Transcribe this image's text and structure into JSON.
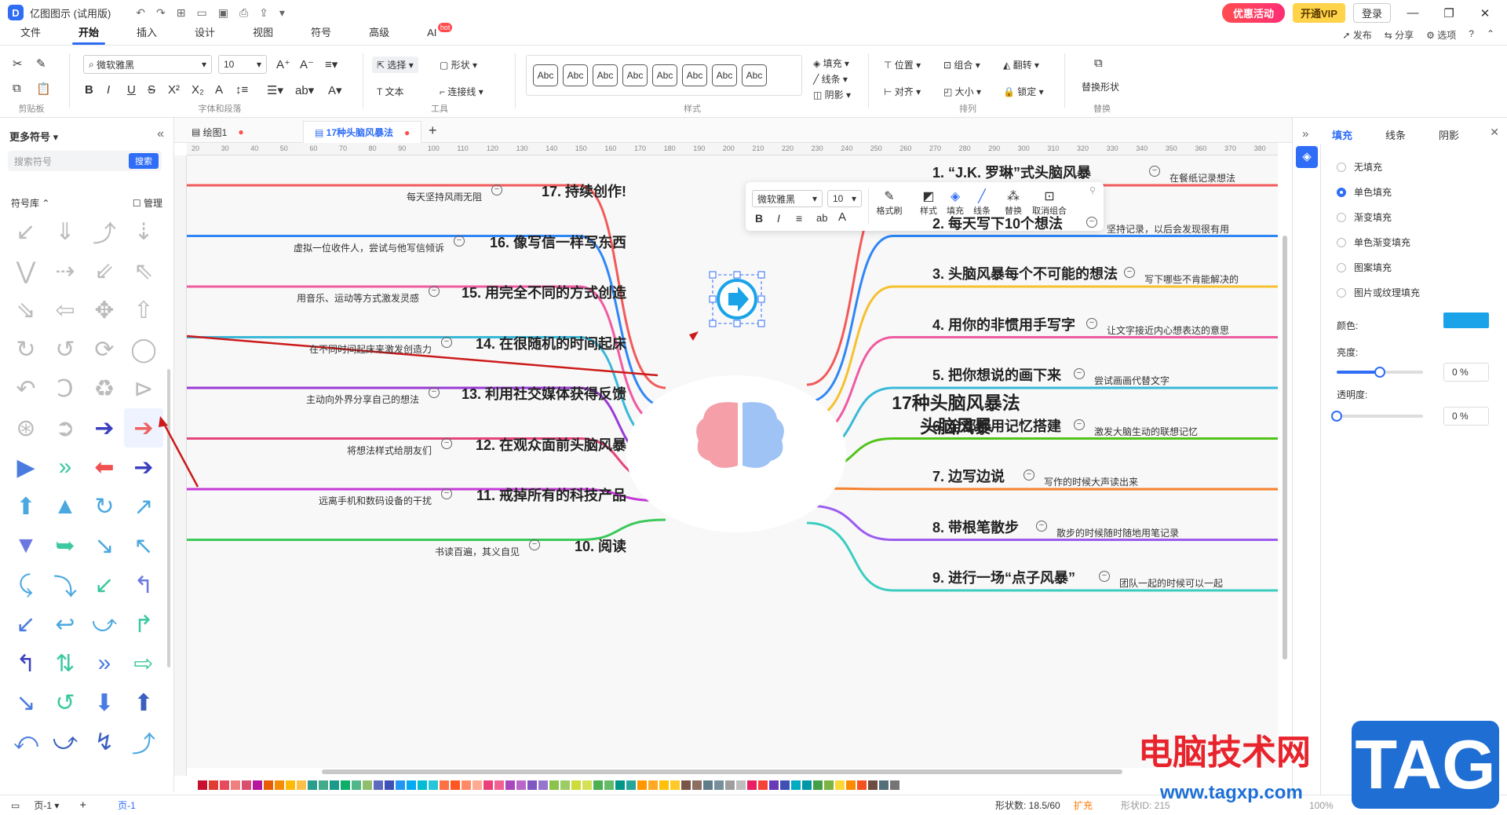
{
  "app": {
    "title": "亿图图示 (试用版)",
    "promo": "优惠活动",
    "vip": "开通VIP",
    "login": "登录"
  },
  "menu": [
    {
      "label": "文件"
    },
    {
      "label": "开始"
    },
    {
      "label": "插入"
    },
    {
      "label": "设计"
    },
    {
      "label": "视图"
    },
    {
      "label": "符号"
    },
    {
      "label": "高级"
    },
    {
      "label": "AI"
    }
  ],
  "menu_hot": "hot",
  "menu_right": {
    "publish": "发布",
    "share": "分享",
    "options": "选项"
  },
  "ribbon": {
    "clipboard_label": "剪贴板",
    "font_name": "微软雅黑",
    "font_size": "10",
    "font_label": "字体和段落",
    "select": "选择",
    "shape": "形状",
    "text": "文本",
    "connector": "连接线",
    "tools_label": "工具",
    "style_label": "样式",
    "fill": "填充",
    "line": "线条",
    "shadow": "阴影",
    "position": "位置",
    "group": "组合",
    "flip": "翻转",
    "align": "对齐",
    "size": "大小",
    "lock": "锁定",
    "arrange_label": "排列",
    "replace_shape": "替换形状",
    "replace_label": "替换",
    "abc": "Abc"
  },
  "left_panel": {
    "title": "更多符号",
    "search_placeholder": "搜索符号",
    "search_btn": "搜索",
    "library": "符号库",
    "manage": "管理"
  },
  "tabs": [
    {
      "label": "绘图1"
    },
    {
      "label": "17种头脑风暴法"
    }
  ],
  "ruler_ticks": [
    "20",
    "30",
    "40",
    "50",
    "60",
    "70",
    "80",
    "90",
    "100",
    "110",
    "120",
    "130",
    "140",
    "150",
    "160",
    "170",
    "180",
    "190",
    "200",
    "210",
    "220",
    "230",
    "240",
    "250",
    "260",
    "270",
    "280",
    "290",
    "300",
    "310",
    "320",
    "330",
    "340",
    "350",
    "360",
    "370",
    "380"
  ],
  "floating_toolbar": {
    "font": "微软雅黑",
    "size": "10",
    "format_painter": "格式刷",
    "style": "样式",
    "fill": "填充",
    "line": "线条",
    "replace": "替换",
    "ungroup": "取消组合"
  },
  "mindmap": {
    "center_line1": "17种头脑风暴法",
    "center_line2": "头脑风暴",
    "right": [
      {
        "topic": "1. “J.K. 罗琳”式头脑风暴",
        "note": "在餐纸记录想法",
        "color": "#f25a5a"
      },
      {
        "topic": "2. 每天写下10个想法",
        "note": "坚持记录，以后会发现很有用",
        "color": "#2f86f6"
      },
      {
        "topic": "3. 头脑风暴每个不可能的想法",
        "note": "写下哪些不肯能解决的",
        "color": "#f6c12f"
      },
      {
        "topic": "4. 用你的非惯用手写字",
        "note": "让文字接近内心想表达的意思",
        "color": "#ef5ba1"
      },
      {
        "topic": "5. 把你想说的画下来",
        "note": "尝试画画代替文字",
        "color": "#39b8d8"
      },
      {
        "topic": "6. 全部都用记忆搭建",
        "note": "激发大脑生动的联想记忆",
        "color": "#52c41a"
      },
      {
        "topic": "7. 边写边说",
        "note": "写作的时候大声读出来",
        "color": "#f5822d"
      },
      {
        "topic": "8. 带根笔散步",
        "note": "散步的时候随时随地用笔记录",
        "color": "#9b5cf0"
      },
      {
        "topic": "9. 进行一场“点子风暴”",
        "note": "团队一起的时候可以一起",
        "color": "#3ccdc0"
      }
    ],
    "left": [
      {
        "topic": "17. 持续创作!",
        "note": "每天坚持风雨无阻",
        "color": "#f25a5a"
      },
      {
        "topic": "16. 像写信一样写东西",
        "note": "虚拟一位收件人，尝试与他写信倾诉",
        "color": "#2f86f6"
      },
      {
        "topic": "15. 用完全不同的方式创造",
        "note": "用音乐、运动等方式激发灵感",
        "color": "#ef5ba1"
      },
      {
        "topic": "14. 在很随机的时间起床",
        "note": "在不同时间起床来激发创造力",
        "color": "#39b8d8"
      },
      {
        "topic": "13. 利用社交媒体获得反馈",
        "note": "主动向外界分享自己的想法",
        "color": "#9b3ad6"
      },
      {
        "topic": "12. 在观众面前头脑风暴",
        "note": "将想法样式给朋友们",
        "color": "#e5457a"
      },
      {
        "topic": "11. 戒掉所有的科技产品",
        "note": "远离手机和数码设备的干扰",
        "color": "#c43ad6"
      },
      {
        "topic": "10. 阅读",
        "note": "书读百遍，其义自见",
        "color": "#3cc85a"
      }
    ]
  },
  "right_panel": {
    "tabs": [
      {
        "label": "填充"
      },
      {
        "label": "线条"
      },
      {
        "label": "阴影"
      }
    ],
    "options": [
      {
        "label": "无填充"
      },
      {
        "label": "单色填充"
      },
      {
        "label": "渐变填充"
      },
      {
        "label": "单色渐变填充"
      },
      {
        "label": "图案填充"
      },
      {
        "label": "图片或纹理填充"
      }
    ],
    "color_label": "颜色:",
    "color_value": "#1aa3e8",
    "brightness_label": "亮度:",
    "brightness_value": "0 %",
    "brightness_level": 0.5,
    "opacity_label": "透明度:",
    "opacity_value": "0 %",
    "opacity_level": 0
  },
  "status": {
    "page_label": "页-1",
    "page_tab": "页-1",
    "shape_count": "形状数: 18.5/60",
    "expand": "扩充",
    "shape_id": "形状ID: 215",
    "zoom": "100%"
  },
  "watermark": {
    "text": "电脑技术网",
    "url": "www.tagxp.com",
    "tag": "TAG"
  },
  "palette": [
    "#c8102e",
    "#e03c31",
    "#e64a5c",
    "#f08080",
    "#d94f70",
    "#b5179e",
    "#e85d04",
    "#f48c06",
    "#ffba08",
    "#fcbf49",
    "#2a9d8f",
    "#43aa8b",
    "#1b998b",
    "#0ead69",
    "#52b788",
    "#90be6d",
    "#5c6bc0",
    "#3f51b5",
    "#2196f3",
    "#03a9f4",
    "#00bcd4",
    "#26c6da",
    "#ff7043",
    "#ff5722",
    "#ff8a65",
    "#ffab91",
    "#ec407a",
    "#f06292",
    "#ab47bc",
    "#ba68c8",
    "#7e57c2",
    "#9575cd",
    "#8bc34a",
    "#9ccc65",
    "#cddc39",
    "#d4e157",
    "#4caf50",
    "#66bb6a",
    "#009688",
    "#26a69a",
    "#ff9800",
    "#ffa726",
    "#ffc107",
    "#ffca28",
    "#795548",
    "#8d6e63",
    "#607d8b",
    "#78909c",
    "#9e9e9e",
    "#bdbdbd",
    "#e91e63",
    "#f44336",
    "#673ab7",
    "#3f51b5",
    "#00acc1",
    "#0097a7",
    "#43a047",
    "#7cb342",
    "#fdd835",
    "#fb8c00",
    "#f4511e",
    "#6d4c41",
    "#546e7a",
    "#757575"
  ]
}
